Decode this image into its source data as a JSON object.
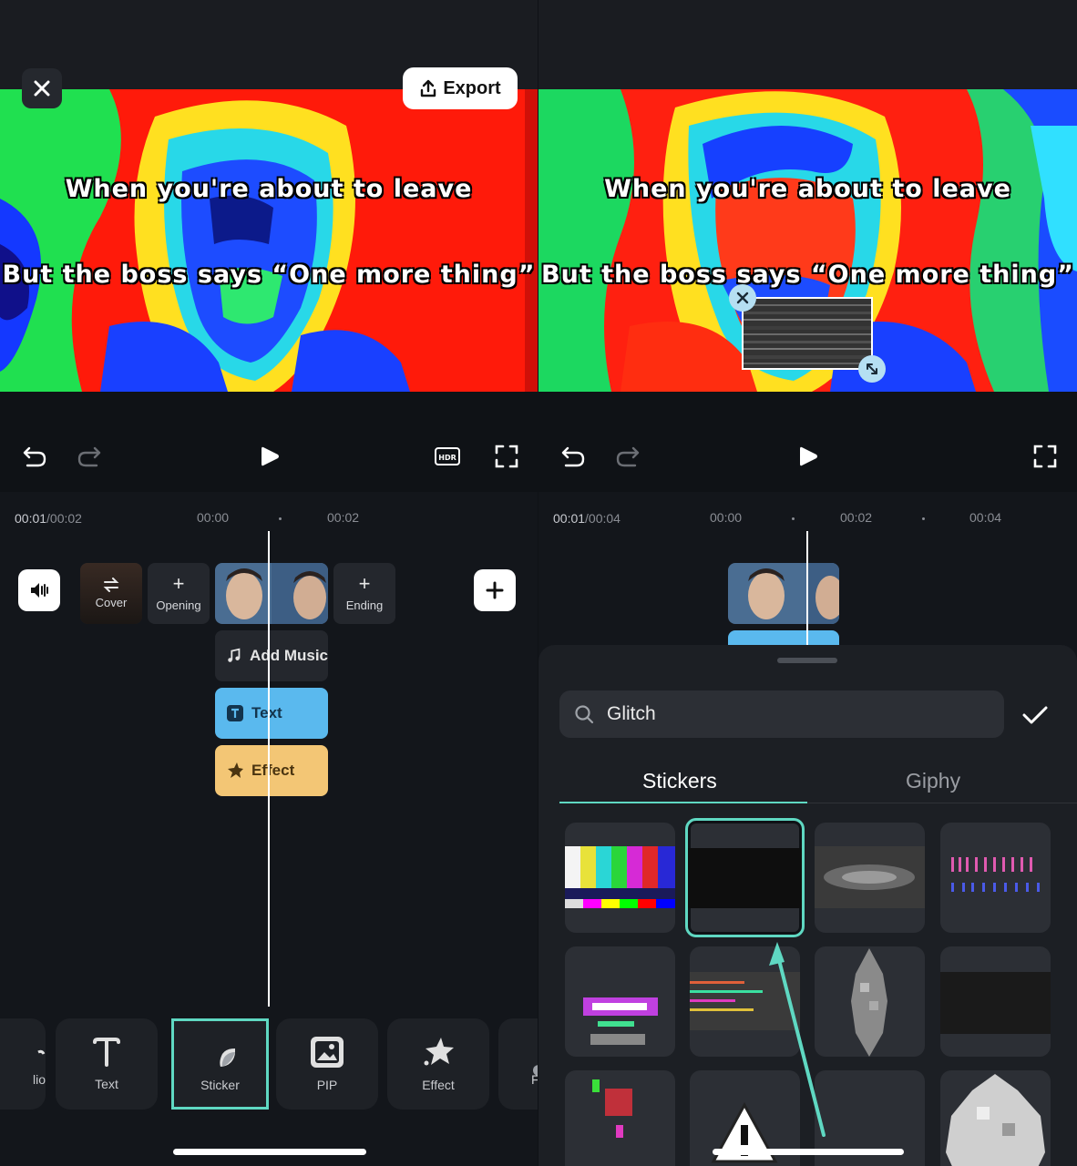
{
  "left": {
    "export_label": "Export",
    "caption_line1": "When you're about to leave",
    "caption_line2": "But the boss says “One more thing”",
    "time_current": "00:01",
    "time_total": "/00:02",
    "ticks": [
      "00:00",
      "00:02"
    ],
    "clips": {
      "cover": "Cover",
      "opening": "Opening",
      "ending": "Ending"
    },
    "tracks": {
      "music": "Add Music",
      "text": "Text",
      "effect": "Effect"
    },
    "toolbar": {
      "audio_partial": "lio",
      "text": "Text",
      "sticker": "Sticker",
      "pip": "PIP",
      "effect": "Effect",
      "filter_partial": "F"
    }
  },
  "right": {
    "caption_line1": "When you're about to leave",
    "caption_line2": "But the boss says “One more thing”",
    "time_current": "00:01",
    "time_total": "/00:04",
    "ticks": [
      "00:00",
      "00:02",
      "00:04"
    ],
    "search": {
      "value": "Glitch"
    },
    "tabs": {
      "stickers": "Stickers",
      "giphy": "Giphy"
    }
  },
  "colors": {
    "accent": "#5fd8c2",
    "text_track": "#5ab9ee",
    "effect_track": "#f3c675",
    "music_track": "#24272d"
  }
}
